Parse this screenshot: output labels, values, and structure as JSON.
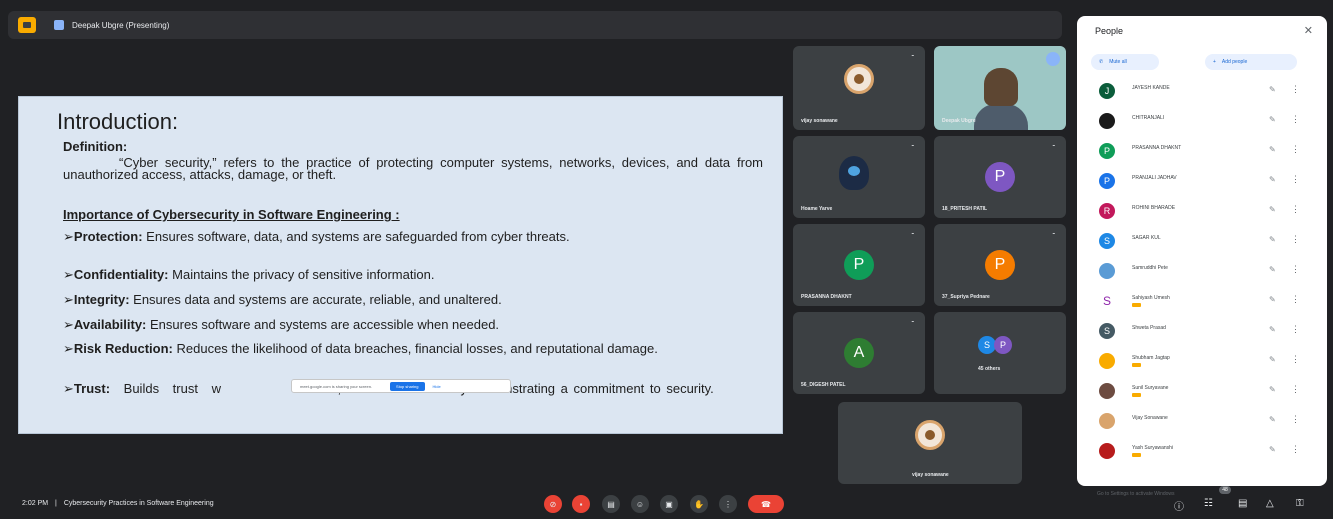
{
  "presenter": {
    "label": "Deepak Ubgre (Presenting)"
  },
  "slide": {
    "title": "Introduction:",
    "definition_heading": "Definition:",
    "definition_text": "“Cyber security,” refers to the practice of protecting computer systems, networks, devices, and data from unauthorized access, attacks, damage, or theft.",
    "importance_heading": "Importance of Cybersecurity in Software Engineering :",
    "bullets": [
      {
        "term": "Protection:",
        "text": "Ensures software, data, and systems are safeguarded from cyber threats."
      },
      {
        "term": "Confidentiality:",
        "text": "Maintains the privacy of sensitive information."
      },
      {
        "term": "Integrity:",
        "text": "Ensures data and systems are accurate, reliable, and unaltered."
      },
      {
        "term": "Availability:",
        "text": "Ensures software and systems are accessible when needed."
      },
      {
        "term": "Risk Reduction:",
        "text": "Reduces the likelihood of data breaches, financial losses, and reputational damage."
      },
      {
        "term": "Trust:",
        "text": "Builds trust w",
        "text_end": "s, and stakeholders by demonstrating a commitment to security."
      }
    ],
    "popup": {
      "text": "meet.google.com is sharing your screen.",
      "primary": "Stop sharing",
      "secondary": "Hide"
    }
  },
  "tiles": [
    {
      "name": "vijay sonawane"
    },
    {
      "name": "Deepak Ubgre"
    },
    {
      "name": "Hoame Yarve"
    },
    {
      "name": "18_PRITESH PATIL",
      "initial": "P"
    },
    {
      "name": "PRASANNA DHAKNT",
      "initial": "P"
    },
    {
      "name": "37_Supriya Pednare",
      "initial": "P"
    },
    {
      "name": "56_DIGESH PATEL",
      "initial": "A"
    },
    {
      "name": "45 others",
      "initials": [
        "S",
        "P"
      ]
    },
    {
      "name": "vijay sonawane"
    }
  ],
  "people": {
    "title": "People",
    "mute_all": "Mute all",
    "add_people": "Add people",
    "list": [
      {
        "initial": "J",
        "name": "JAYESH KANDE",
        "color": "#0b5d3b",
        "hand": false
      },
      {
        "initial": "",
        "name": "CHITRANJALI",
        "color": "#1a1a1a",
        "hand": false
      },
      {
        "initial": "P",
        "name": "PRASANNA DHAKNT",
        "color": "#0f9d58",
        "hand": false
      },
      {
        "initial": "P",
        "name": "PRANJALI JADHAV",
        "color": "#1a73e8",
        "hand": false
      },
      {
        "initial": "R",
        "name": "ROHINI BHARADE",
        "color": "#c2185b",
        "hand": false
      },
      {
        "initial": "S",
        "name": "SAGAR KUL",
        "color": "#1e88e5",
        "hand": false
      },
      {
        "initial": "",
        "name": "Samruddhi Pete",
        "color": "#5a9bd5",
        "hand": false
      },
      {
        "initial": "S",
        "name": "Sahiyash Umesh",
        "color": "#ffffff",
        "hand": true
      },
      {
        "initial": "S",
        "name": "Shweta Prasad",
        "color": "#455a64",
        "hand": false
      },
      {
        "initial": "",
        "name": "Shubham Jagtap",
        "color": "#f9ab00",
        "hand": true
      },
      {
        "initial": "",
        "name": "Sunil Suryavane",
        "color": "#6d4c41",
        "hand": true
      },
      {
        "initial": "",
        "name": "Vijay Sonawane",
        "color": "#d9a46c",
        "hand": false
      },
      {
        "initial": "",
        "name": "Yash Suryawanshi",
        "color": "#b71c1c",
        "hand": true
      }
    ]
  },
  "bottom": {
    "time": "2:02 PM",
    "separator": "|",
    "meeting_title": "Cybersecurity Practices in Software Engineering",
    "participant_count": "48",
    "overlay_hint": "Go to Settings to activate Windows"
  }
}
